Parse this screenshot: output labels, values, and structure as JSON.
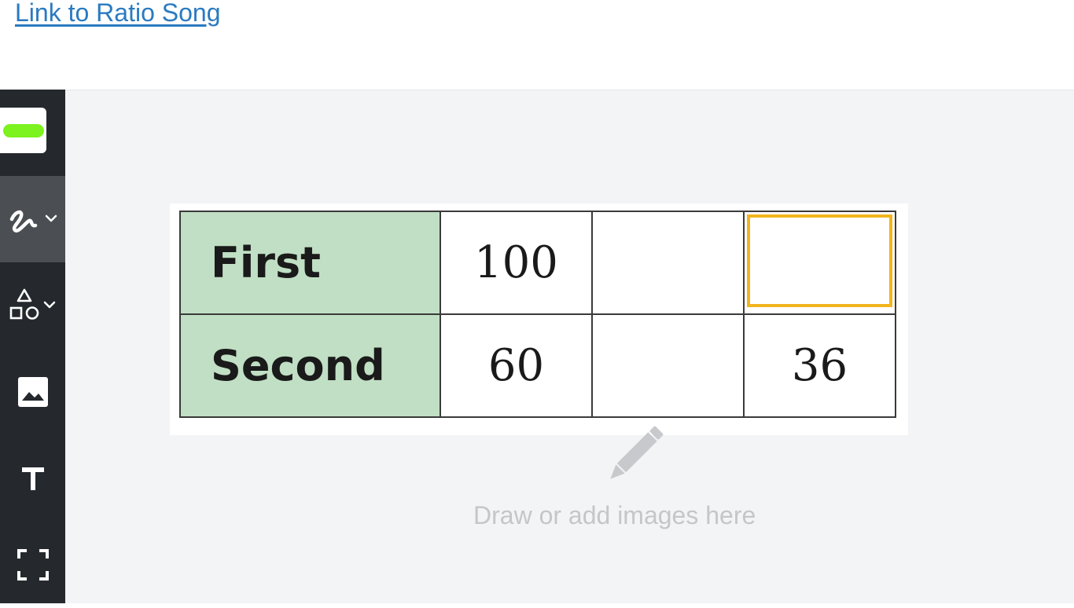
{
  "header": {
    "link_text": "Link to Ratio Song"
  },
  "toolbar": {
    "color_swatch": "#7cf21e",
    "tools": [
      {
        "name": "pen",
        "icon": "pen-icon",
        "has_dropdown": true,
        "active": true
      },
      {
        "name": "shapes",
        "icon": "shapes-icon",
        "has_dropdown": true,
        "active": false
      },
      {
        "name": "image",
        "icon": "image-icon",
        "has_dropdown": false,
        "active": false
      },
      {
        "name": "text",
        "icon": "text-icon",
        "has_dropdown": false,
        "active": false
      },
      {
        "name": "fullscreen",
        "icon": "fullscreen-icon",
        "has_dropdown": false,
        "active": false
      }
    ]
  },
  "canvas": {
    "table": {
      "rows": [
        {
          "label": "First",
          "values": [
            "100",
            "",
            ""
          ]
        },
        {
          "label": "Second",
          "values": [
            "60",
            "",
            "36"
          ]
        }
      ],
      "label_bg": "#c0dfc4",
      "highlight_color": "#f2b51c"
    },
    "placeholder": {
      "icon": "pencil-icon",
      "text": "Draw or add images here"
    }
  }
}
